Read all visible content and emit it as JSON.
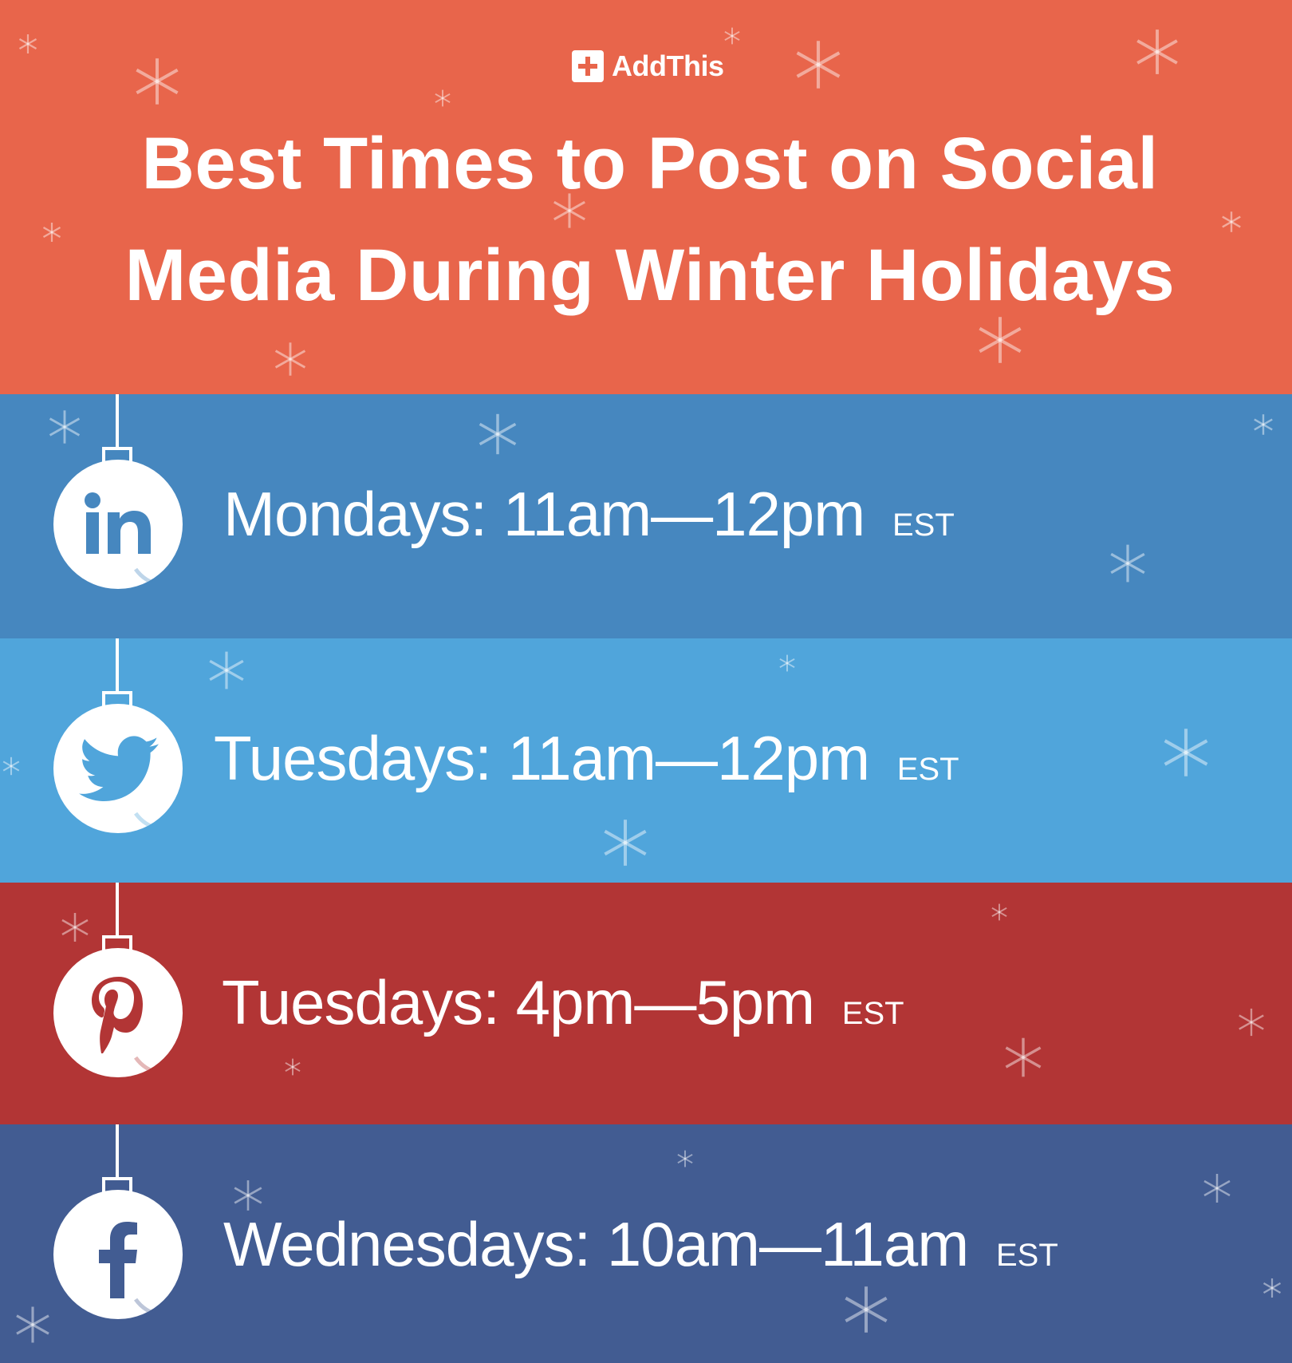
{
  "brand": {
    "name": "AddThis"
  },
  "title": {
    "line1": "Best Times to Post on Social",
    "line2": "Media During Winter Holidays"
  },
  "rows": [
    {
      "network_icon": "linkedin-icon",
      "days": "Mondays:",
      "time": "11am—12pm",
      "tz": "EST",
      "color": "#4687BF"
    },
    {
      "network_icon": "twitter-icon",
      "days": "Tuesdays:",
      "time": "11am—12pm",
      "tz": "EST",
      "color": "#50A5DB"
    },
    {
      "network_icon": "pinterest-icon",
      "days": "Tuesdays:",
      "time": "4pm—5pm",
      "tz": "EST",
      "color": "#B23535"
    },
    {
      "network_icon": "facebook-icon",
      "days": "Wednesdays:",
      "time": "10am—11am",
      "tz": "EST",
      "color": "#425C92"
    }
  ],
  "colors": {
    "header_bg": "#E8654B",
    "text": "#FFFFFF"
  },
  "decorations": {
    "icon": "snowflake-icon"
  }
}
